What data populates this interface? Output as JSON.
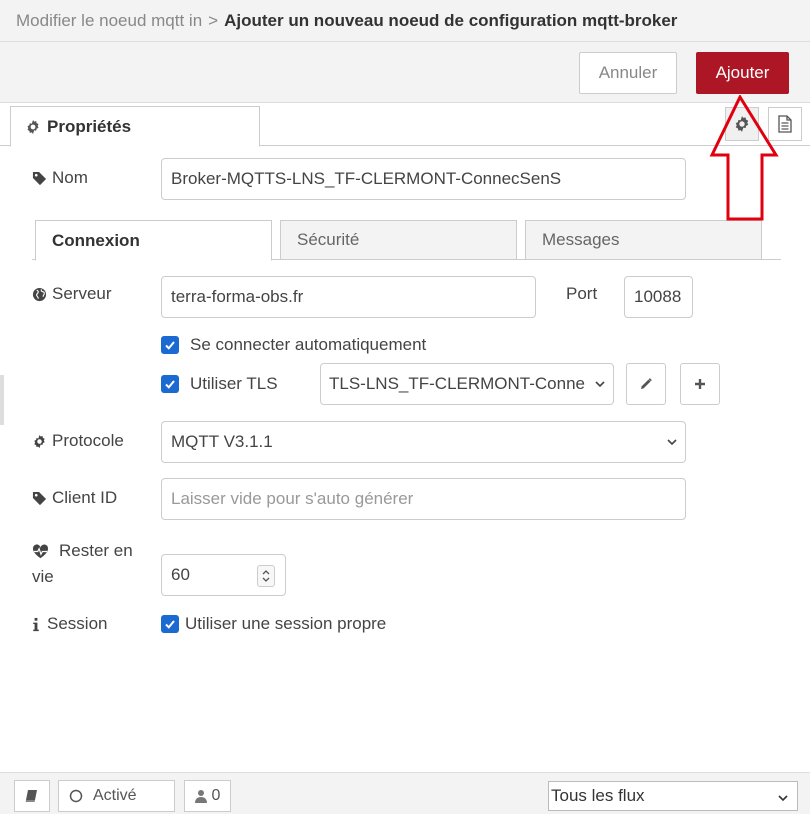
{
  "breadcrumb": {
    "parent": "Modifier le noeud mqtt in",
    "separator": ">",
    "current": "Ajouter un nouveau noeud de configuration mqtt-broker"
  },
  "actions": {
    "cancel_label": "Annuler",
    "add_label": "Ajouter"
  },
  "tabs": {
    "properties_label": "Propriétés"
  },
  "form": {
    "name_label": "Nom",
    "name_value": "Broker-MQTTS-LNS_TF-CLERMONT-ConnecSenS",
    "subtabs": [
      "Connexion",
      "Sécurité",
      "Messages"
    ],
    "server_label": "Serveur",
    "server_value": "terra-forma-obs.fr",
    "port_label": "Port",
    "port_value": "10088",
    "auto_connect_label": "Se connecter automatiquement",
    "auto_connect_checked": true,
    "use_tls_label": "Utiliser TLS",
    "use_tls_checked": true,
    "tls_config_value": "TLS-LNS_TF-CLERMONT-Conne",
    "protocol_label": "Protocole",
    "protocol_value": "MQTT V3.1.1",
    "client_id_label": "Client ID",
    "client_id_placeholder": "Laisser vide pour s'auto générer",
    "keepalive_label_line1": "Rester en",
    "keepalive_label_line2": "vie",
    "keepalive_value": "60",
    "session_label": "Session",
    "clean_session_label": "Utiliser une session propre",
    "clean_session_checked": true
  },
  "footer": {
    "status_label": "Activé",
    "users_count": "0",
    "scope_value": "Tous les flux"
  },
  "colors": {
    "accent_red": "#ad1625",
    "checkbox_blue": "#1b6ad1",
    "annotation_arrow": "#e0000f"
  }
}
